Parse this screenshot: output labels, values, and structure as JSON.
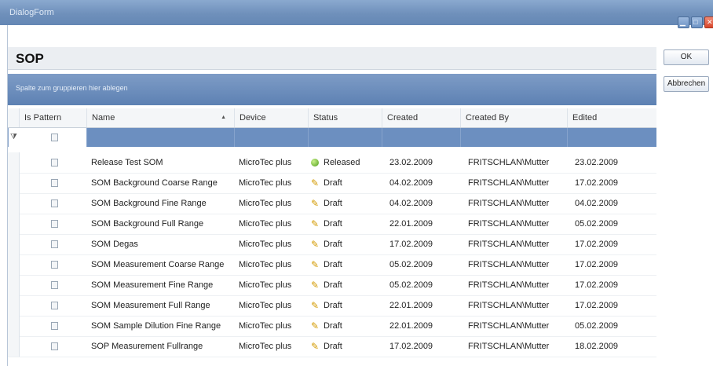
{
  "window": {
    "title": "DialogForm"
  },
  "panel": {
    "title": "SOP",
    "group_hint": "Spalte zum gruppieren hier ablegen"
  },
  "buttons": {
    "ok": "OK",
    "cancel": "Abbrechen"
  },
  "grid": {
    "columns": [
      "Is Pattern",
      "Name",
      "Device",
      "Status",
      "Created",
      "Created By",
      "Edited"
    ],
    "sort": {
      "column": "Name",
      "direction": "ascending"
    },
    "rows": [
      {
        "name": "Release Test SOM",
        "device": "MicroTec plus",
        "status": "Released",
        "created": "23.02.2009",
        "created_by": "FRITSCHLAN\\Mutter",
        "edited": "23.02.2009"
      },
      {
        "name": "SOM Background Coarse Range",
        "device": "MicroTec plus",
        "status": "Draft",
        "created": "04.02.2009",
        "created_by": "FRITSCHLAN\\Mutter",
        "edited": "17.02.2009"
      },
      {
        "name": "SOM Background Fine Range",
        "device": "MicroTec plus",
        "status": "Draft",
        "created": "04.02.2009",
        "created_by": "FRITSCHLAN\\Mutter",
        "edited": "04.02.2009"
      },
      {
        "name": "SOM Background Full Range",
        "device": "MicroTec plus",
        "status": "Draft",
        "created": "22.01.2009",
        "created_by": "FRITSCHLAN\\Mutter",
        "edited": "05.02.2009"
      },
      {
        "name": "SOM Degas",
        "device": "MicroTec plus",
        "status": "Draft",
        "created": "17.02.2009",
        "created_by": "FRITSCHLAN\\Mutter",
        "edited": "17.02.2009"
      },
      {
        "name": "SOM Measurement Coarse Range",
        "device": "MicroTec plus",
        "status": "Draft",
        "created": "05.02.2009",
        "created_by": "FRITSCHLAN\\Mutter",
        "edited": "17.02.2009"
      },
      {
        "name": "SOM Measurement Fine Range",
        "device": "MicroTec plus",
        "status": "Draft",
        "created": "05.02.2009",
        "created_by": "FRITSCHLAN\\Mutter",
        "edited": "17.02.2009"
      },
      {
        "name": "SOM Measurement Full Range",
        "device": "MicroTec plus",
        "status": "Draft",
        "created": "22.01.2009",
        "created_by": "FRITSCHLAN\\Mutter",
        "edited": "17.02.2009"
      },
      {
        "name": "SOM Sample Dilution Fine Range",
        "device": "MicroTec plus",
        "status": "Draft",
        "created": "22.01.2009",
        "created_by": "FRITSCHLAN\\Mutter",
        "edited": "05.02.2009"
      },
      {
        "name": "SOP Measurement Fullrange",
        "device": "MicroTec plus",
        "status": "Draft",
        "created": "17.02.2009",
        "created_by": "FRITSCHLAN\\Mutter",
        "edited": "18.02.2009"
      }
    ]
  },
  "colors": {
    "accent": "#6c8fc0",
    "released": "#4f9e1c",
    "draft": "#d39a00"
  },
  "icons": {
    "status_released": "green-circle-icon",
    "status_draft": "pencil-icon",
    "filter": "filter-icon"
  }
}
